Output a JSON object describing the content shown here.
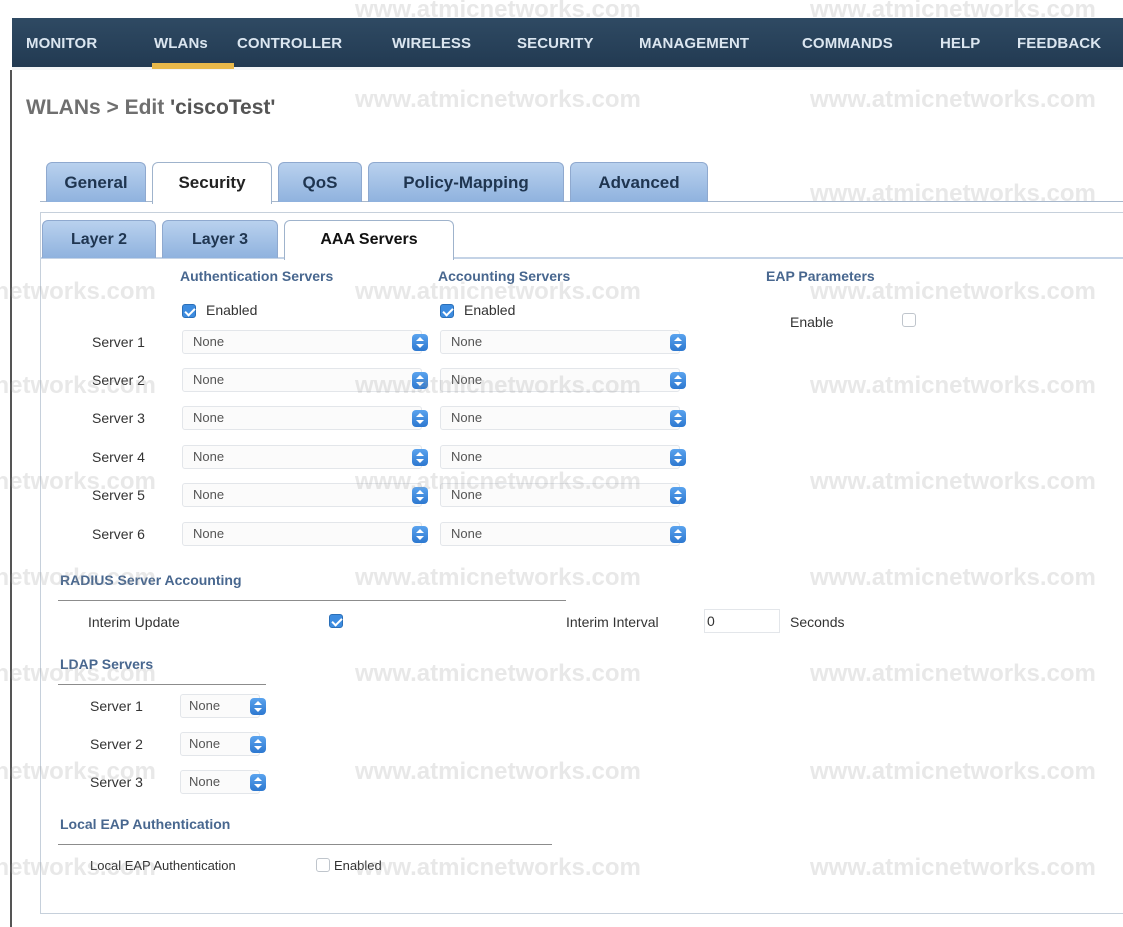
{
  "nav": {
    "items": [
      "MONITOR",
      "WLANs",
      "CONTROLLER",
      "WIRELESS",
      "SECURITY",
      "MANAGEMENT",
      "COMMANDS",
      "HELP",
      "FEEDBACK"
    ],
    "active": "WLANs"
  },
  "page": {
    "title_prefix": "WLANs > Edit ",
    "title_name": "'ciscoTest'"
  },
  "tabs": [
    "General",
    "Security",
    "QoS",
    "Policy-Mapping",
    "Advanced"
  ],
  "active_tab": "Security",
  "subtabs": [
    "Layer 2",
    "Layer 3",
    "AAA Servers"
  ],
  "active_subtab": "AAA Servers",
  "auth": {
    "heading": "Authentication Servers",
    "enabled_label": "Enabled",
    "enabled": true
  },
  "acct": {
    "heading": "Accounting Servers",
    "enabled_label": "Enabled",
    "enabled": true
  },
  "eap_params": {
    "heading": "EAP Parameters",
    "enable_label": "Enable",
    "enabled": false
  },
  "servers": [
    {
      "label": "Server 1",
      "auth": "None",
      "acct": "None"
    },
    {
      "label": "Server 2",
      "auth": "None",
      "acct": "None"
    },
    {
      "label": "Server 3",
      "auth": "None",
      "acct": "None"
    },
    {
      "label": "Server 4",
      "auth": "None",
      "acct": "None"
    },
    {
      "label": "Server 5",
      "auth": "None",
      "acct": "None"
    },
    {
      "label": "Server 6",
      "auth": "None",
      "acct": "None"
    }
  ],
  "radius_accounting": {
    "heading": "RADIUS Server Accounting",
    "interim_update_label": "Interim Update",
    "interim_update": true,
    "interval_label": "Interim Interval",
    "interval_value": "0",
    "interval_unit": "Seconds"
  },
  "ldap": {
    "heading": "LDAP Servers",
    "servers": [
      {
        "label": "Server 1",
        "value": "None"
      },
      {
        "label": "Server 2",
        "value": "None"
      },
      {
        "label": "Server 3",
        "value": "None"
      }
    ]
  },
  "local_eap": {
    "heading": "Local EAP Authentication",
    "label": "Local EAP Authentication",
    "enabled_label": "Enabled",
    "enabled": false
  },
  "watermark": "www.atmicnetworks.com",
  "colors": {
    "nav_bg": "#223a52",
    "tab_bg": "#8fb2de",
    "heading": "#48678f",
    "checkbox": "#3d8ce0",
    "active_bar": "#e8b84a"
  }
}
